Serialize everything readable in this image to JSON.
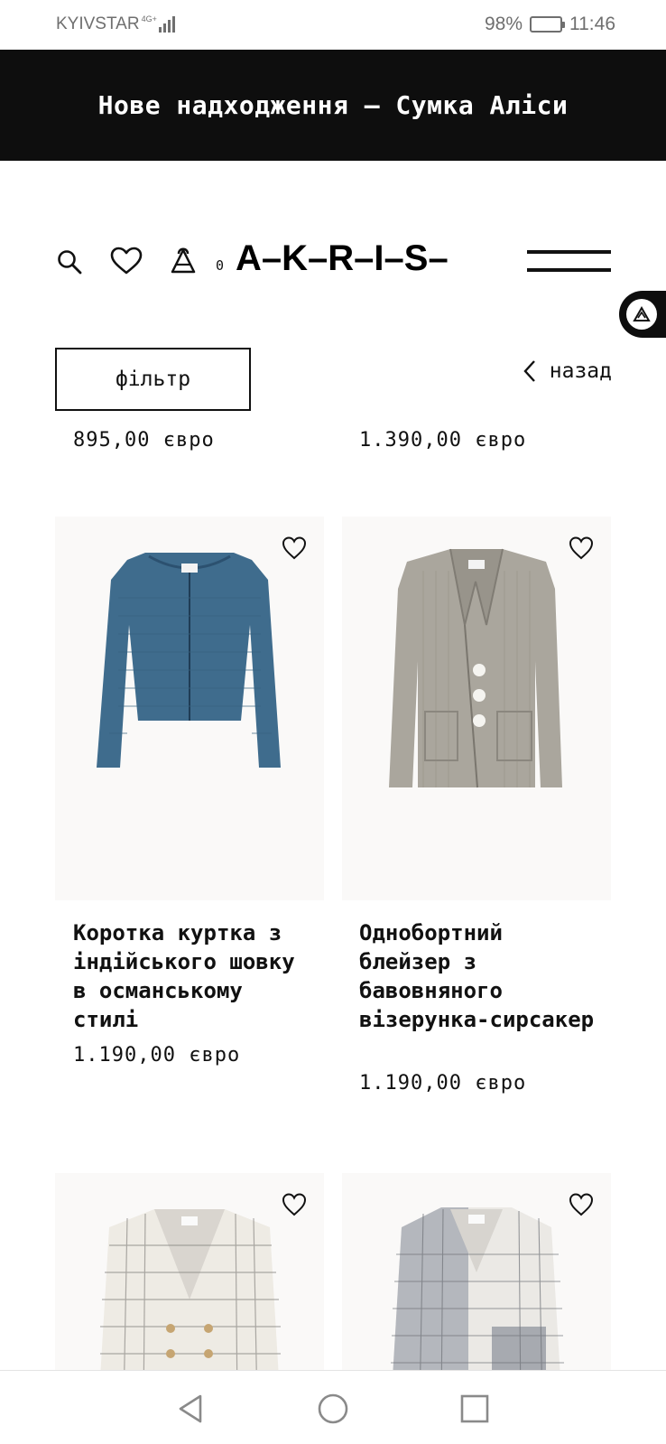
{
  "status_bar": {
    "carrier": "KYIVSTAR",
    "network": "4G+",
    "battery": "98%",
    "battery_level": 0.98,
    "time": "11:46"
  },
  "promo": {
    "text": "Нове надходження – Сумка Аліси"
  },
  "header": {
    "bag_count": "0",
    "logo": "A–K–R–I–S–",
    "icons": [
      "search-icon",
      "heart-icon",
      "bag-icon",
      "menu-icon"
    ]
  },
  "filter": {
    "label": "фільтр"
  },
  "back": {
    "label": "назад"
  },
  "products_prev_row": [
    {
      "price": "895,00 євро"
    },
    {
      "price": "1.390,00 євро"
    }
  ],
  "products": [
    {
      "title": "Коротка куртка з індійського шовку в османському стилі",
      "price": "1.190,00 євро",
      "color": "#3d6a8c"
    },
    {
      "title": "Однобортний блейзер з бавовняного візерунка-сирсакер",
      "price": "1.190,00 євро",
      "color": "#a9a59c"
    },
    {
      "color": "#eeebe4"
    },
    {
      "color": "#e8e6e2"
    }
  ],
  "colors": {
    "promo_bg": "#0e0e0e",
    "card_bg": "#faf9f8",
    "text": "#111111"
  }
}
